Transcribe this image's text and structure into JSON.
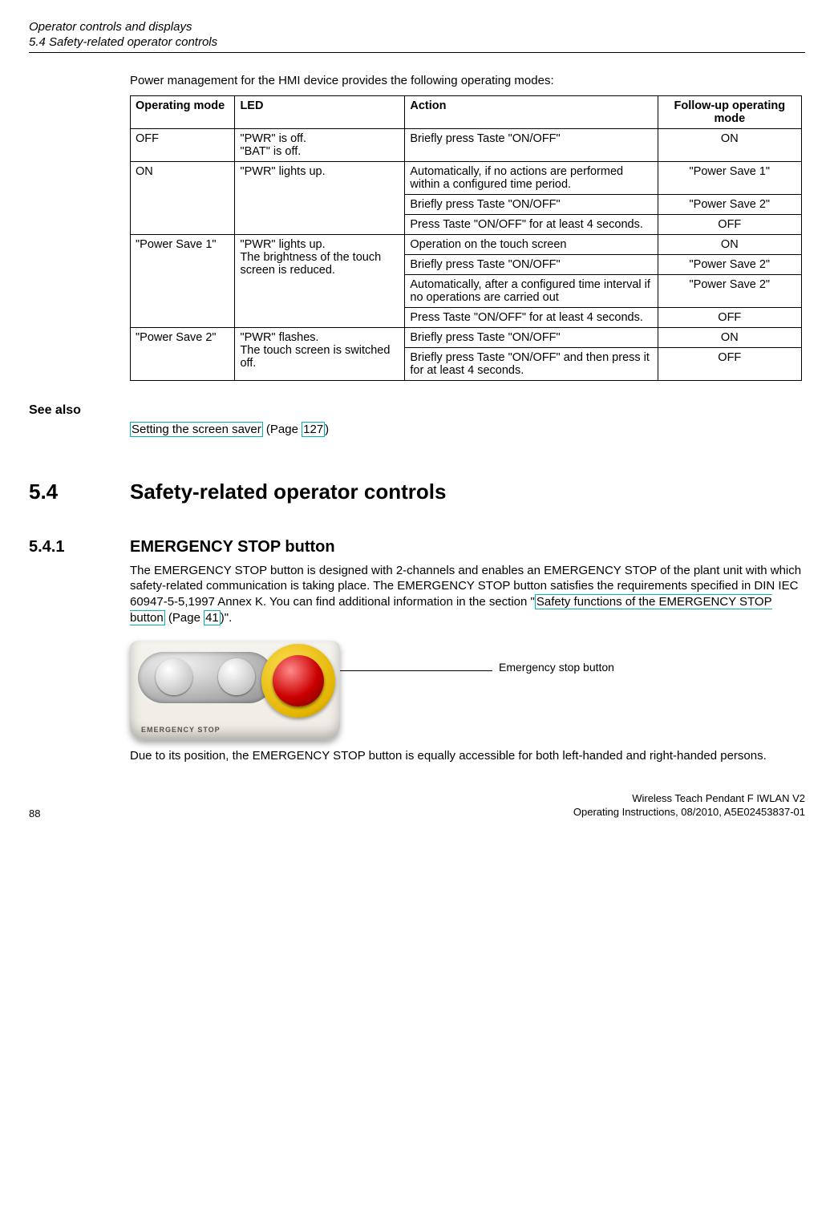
{
  "header": {
    "title": "Operator controls and displays",
    "subtitle": "5.4 Safety-related operator controls"
  },
  "intro": "Power management for the HMI device provides the following operating modes:",
  "table": {
    "head": {
      "c1": "Operating mode",
      "c2": "LED",
      "c3": "Action",
      "c4": "Follow-up operating mode"
    },
    "rows": {
      "r1": {
        "mode": "OFF",
        "led": "\"PWR\" is off.\n\"BAT\" is off.",
        "action": "Briefly press Taste \"ON/OFF\"",
        "next": "ON"
      },
      "r2a": {
        "mode": "ON",
        "led": "\"PWR\" lights up.",
        "action": "Automatically, if no actions are performed within a configured time period.",
        "next": "\"Power Save 1\""
      },
      "r2b": {
        "action": "Briefly press Taste \"ON/OFF\"",
        "next": "\"Power Save 2\""
      },
      "r2c": {
        "action": "Press Taste \"ON/OFF\" for at least 4 seconds.",
        "next": "OFF"
      },
      "r3a": {
        "mode": "\"Power Save 1\"",
        "led": "\"PWR\" lights up.\nThe brightness of the touch screen is reduced.",
        "action": "Operation on the touch screen",
        "next": "ON"
      },
      "r3b": {
        "action": "Briefly press Taste \"ON/OFF\"",
        "next": "\"Power Save 2\""
      },
      "r3c": {
        "action": "Automatically, after a configured time interval if no operations are carried out",
        "next": "\"Power Save 2\""
      },
      "r3d": {
        "action": "Press Taste \"ON/OFF\" for at least 4 seconds.",
        "next": "OFF"
      },
      "r4a": {
        "mode": "\"Power Save 2\"",
        "led": "\"PWR\" flashes.\nThe touch screen is switched off.",
        "action": "Briefly press Taste \"ON/OFF\"",
        "next": "ON"
      },
      "r4b": {
        "action": "Briefly press Taste \"ON/OFF\" and then press it for at least 4 seconds.",
        "next": "OFF"
      }
    }
  },
  "see_also": {
    "heading": "See also",
    "link_text": "Setting the screen saver",
    "mid": " (Page ",
    "page": "127",
    "end": ")"
  },
  "sec54": {
    "num": "5.4",
    "title": "Safety-related operator controls"
  },
  "sec541": {
    "num": "5.4.1",
    "title": "EMERGENCY STOP button"
  },
  "para1_a": "The EMERGENCY STOP button is designed with 2-channels and enables an EMERGENCY STOP of the plant unit with which safety-related communication is taking place. The EMERGENCY STOP button satisfies the requirements specified in DIN IEC 60947-5-5,1997 Annex K. You can find additional information in the section \"",
  "para1_link": "Safety functions of the EMERGENCY STOP button",
  "para1_b": " (Page ",
  "para1_page": "41",
  "para1_c": ")\".",
  "fig": {
    "estop_strip_label": "EMERGENCY STOP",
    "callout": "Emergency stop button"
  },
  "para2": "Due to its position, the EMERGENCY STOP button is equally accessible for both left-handed and right-handed persons.",
  "footer": {
    "page": "88",
    "right1": "Wireless Teach Pendant F IWLAN V2",
    "right2": "Operating Instructions, 08/2010, A5E02453837-01"
  }
}
